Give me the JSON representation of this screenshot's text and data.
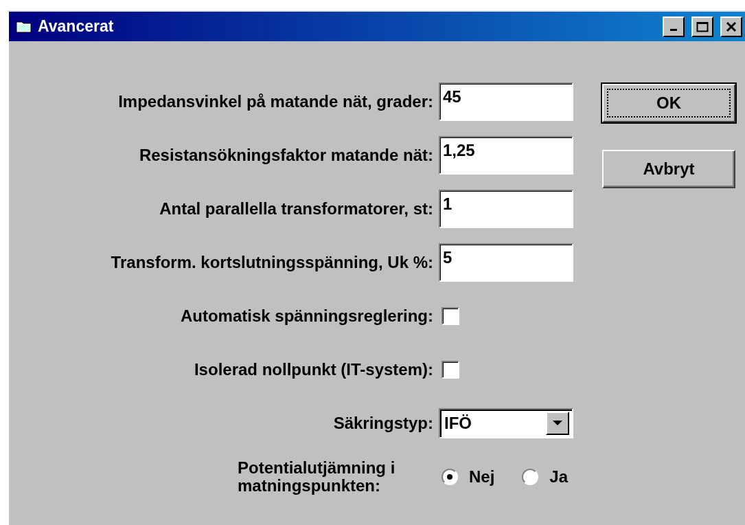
{
  "window": {
    "title": "Avancerat"
  },
  "fields": [
    {
      "kind": "text",
      "label": "Impedansvinkel på matande nät, grader:",
      "value": "45"
    },
    {
      "kind": "text",
      "label": "Resistansökningsfaktor matande nät:",
      "value": "1,25"
    },
    {
      "kind": "text",
      "label": "Antal parallella transformatorer, st:",
      "value": "1"
    },
    {
      "kind": "text",
      "label": "Transform. kortslutningsspänning, Uk %:",
      "value": "5"
    },
    {
      "kind": "checkbox",
      "label": "Automatisk spänningsreglering:",
      "checked": false
    },
    {
      "kind": "checkbox",
      "label": "Isolerad nollpunkt (IT-system):",
      "checked": false
    },
    {
      "kind": "dropdown",
      "label": "Säkringstyp:",
      "value": "IFÖ"
    },
    {
      "kind": "radio",
      "label": "Potentialutjämning i matningspunkten:",
      "options": [
        {
          "label": "Nej",
          "selected": true
        },
        {
          "label": "Ja",
          "selected": false
        }
      ]
    }
  ],
  "buttons": [
    {
      "label": "OK",
      "focused": true
    },
    {
      "label": "Avbryt",
      "focused": false
    }
  ]
}
